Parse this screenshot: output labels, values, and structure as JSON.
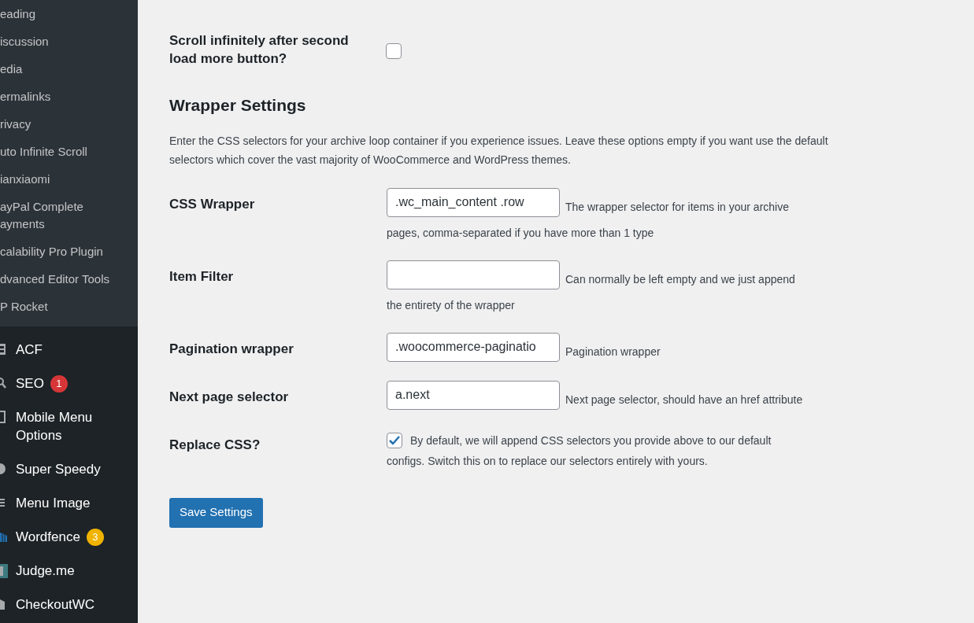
{
  "sidebar": {
    "submenu": [
      "eading",
      "iscussion",
      "edia",
      "ermalinks",
      "rivacy",
      "uto Infinite Scroll",
      "ianxiaomi",
      "ayPal Complete\nayments",
      "calability Pro Plugin",
      "dvanced Editor Tools",
      "P Rocket"
    ],
    "menu": [
      {
        "label": "ACF"
      },
      {
        "label": "SEO",
        "badge": "1",
        "color": "#d63638"
      },
      {
        "label": "Mobile Menu\nOptions"
      },
      {
        "label": "Super Speedy"
      },
      {
        "label": "Menu Image"
      },
      {
        "label": "Wordfence",
        "badge": "3",
        "color": "#f0b300"
      },
      {
        "label": "Judge.me"
      },
      {
        "label": "CheckoutWC"
      }
    ]
  },
  "top_row": {
    "kind": "checkbox",
    "label": "Scroll infinitely after second load more button?",
    "checked": false
  },
  "section": {
    "title": "Wrapper Settings",
    "description": "Enter the CSS selectors for your archive loop container if you experience issues. Leave these options empty if you want use the default selectors which cover the vast majority of WooCommerce and WordPress themes."
  },
  "rows": [
    {
      "kind": "text",
      "label": "CSS Wrapper",
      "value": ".wc_main_content .row",
      "description": [
        "The wrapper selector for items in your archive",
        "pages, comma-separated if you have more than 1 type"
      ]
    },
    {
      "kind": "text",
      "label": "Item Filter",
      "value": "",
      "description": [
        "Can normally be left empty and we just append",
        "the entirety of the wrapper"
      ]
    },
    {
      "kind": "text",
      "label": "Pagination wrapper",
      "value": ".woocommerce-paginatio",
      "description": [
        "Pagination wrapper"
      ]
    },
    {
      "kind": "text",
      "label": "Next page selector",
      "value": "a.next",
      "description": [
        "Next page selector, should have an href attribute"
      ]
    },
    {
      "kind": "checkbox",
      "label": "Replace CSS?",
      "checked": true,
      "description": [
        "By default, we will append CSS selectors you provide above to our default",
        "configs. Switch this on to replace our selectors entirely with yours."
      ]
    }
  ],
  "save_button": "Save Settings"
}
